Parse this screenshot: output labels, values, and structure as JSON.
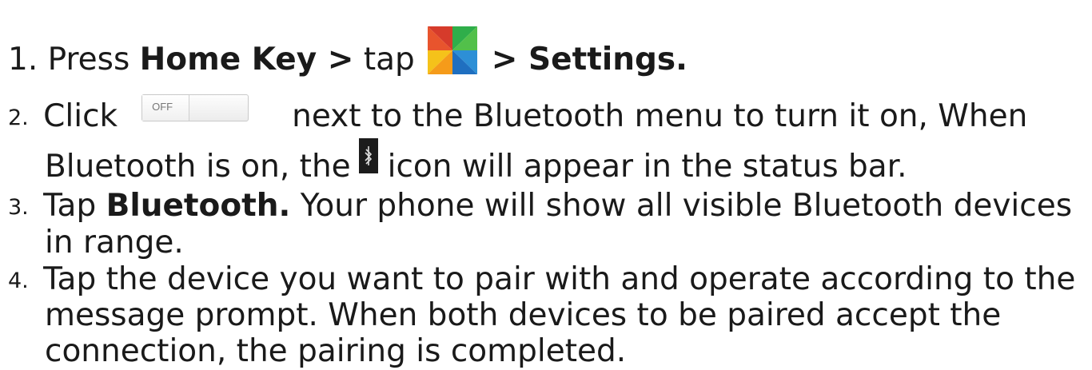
{
  "steps": [
    {
      "number": "1.",
      "prefix": "Press ",
      "home_key": "Home Key >",
      "tap": " tap",
      "settings": "> Settings.",
      "icon": "apps-drawer-icon"
    },
    {
      "number": "2.",
      "click": "Click",
      "toggle_label": "OFF",
      "after_toggle": "next to the Bluetooth menu to turn it on, When",
      "line2_before": "Bluetooth is on, the",
      "line2_after": "icon will appear in the status bar.",
      "icon": "bluetooth-status-icon"
    },
    {
      "number": "3.",
      "tap": "Tap ",
      "bluetooth": "Bluetooth.",
      "rest": " Your phone will show all visible Bluetooth devices",
      "line2": "in range."
    },
    {
      "number": "4.",
      "line1": "Tap the device you want to pair with and operate according to the",
      "line2": "message prompt. When both devices to be paired accept the",
      "line3": "connection, the pairing is completed."
    }
  ],
  "colors": {
    "text": "#1a1a1a",
    "apps_icon": [
      "#e8342d",
      "#2fae4a",
      "#f5c21a",
      "#2d8fd6"
    ]
  }
}
